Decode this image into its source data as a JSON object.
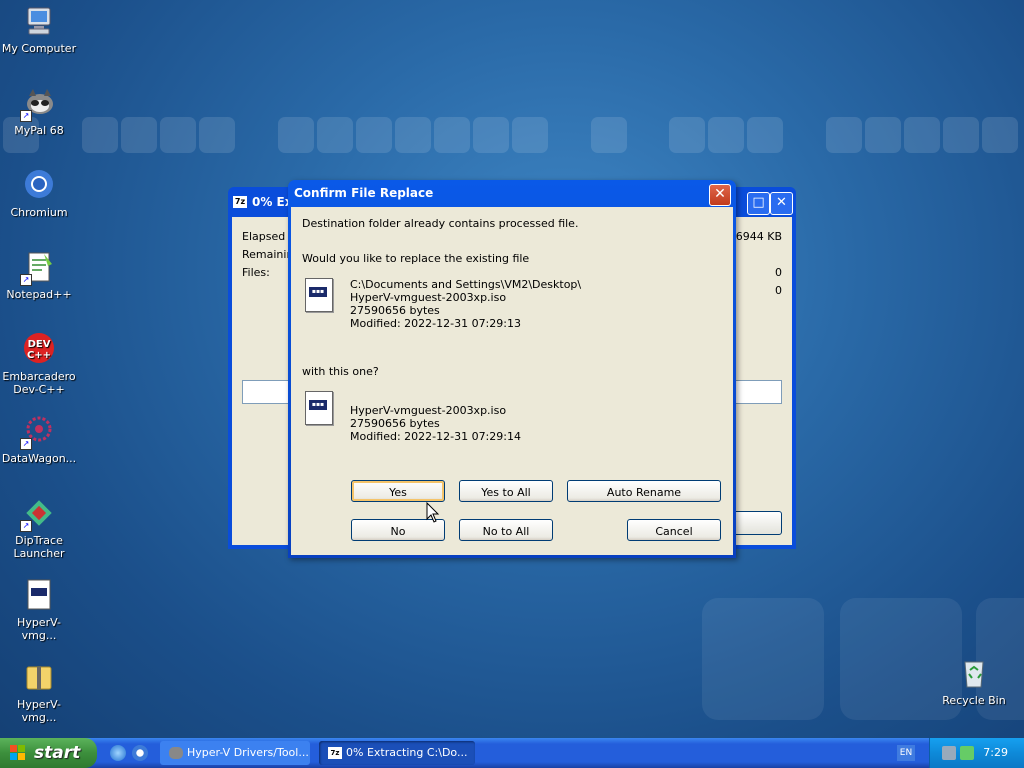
{
  "desktop": {
    "icons": [
      {
        "label": "My Computer"
      },
      {
        "label": "MyPal 68"
      },
      {
        "label": "Chromium"
      },
      {
        "label": "Notepad++"
      },
      {
        "label": "Embarcadero Dev-C++"
      },
      {
        "label": "DataWagon..."
      },
      {
        "label": "DipTrace Launcher"
      },
      {
        "label": "HyperV-vmg..."
      },
      {
        "label": "HyperV-vmg..."
      },
      {
        "label": "Recycle Bin"
      }
    ]
  },
  "progress_window": {
    "title": "0% Ext",
    "elapsed_label": "Elapsed ti",
    "remaining_label": "Remaining",
    "files_label": "Files:",
    "size_value": "26944 KB",
    "value_row2": "0",
    "value_row3": "0"
  },
  "dialog": {
    "title": "Confirm File Replace",
    "message": "Destination folder already contains processed file.",
    "question": "Would you like to replace the existing file",
    "existing": {
      "path": "C:\\Documents and Settings\\VM2\\Desktop\\",
      "name": "HyperV-vmguest-2003xp.iso",
      "size": "27590656 bytes",
      "modified": "Modified: 2022-12-31 07:29:13"
    },
    "with_label": "with this one?",
    "incoming": {
      "name": "HyperV-vmguest-2003xp.iso",
      "size": "27590656 bytes",
      "modified": "Modified: 2022-12-31 07:29:14"
    },
    "buttons": {
      "yes": "Yes",
      "yes_to_all": "Yes to All",
      "auto_rename": "Auto Rename",
      "no": "No",
      "no_to_all": "No to All",
      "cancel": "Cancel"
    }
  },
  "taskbar": {
    "start_label": "start",
    "tasks": [
      {
        "label": "Hyper-V Drivers/Tool..."
      },
      {
        "label": "0% Extracting C:\\Do..."
      }
    ],
    "language": "EN",
    "clock": "7:29"
  },
  "colors": {
    "titlebar": "#0a59e8",
    "dialog_bg": "#ece9d8",
    "taskbar": "#245edb",
    "start_button": "#3c8f3c"
  }
}
